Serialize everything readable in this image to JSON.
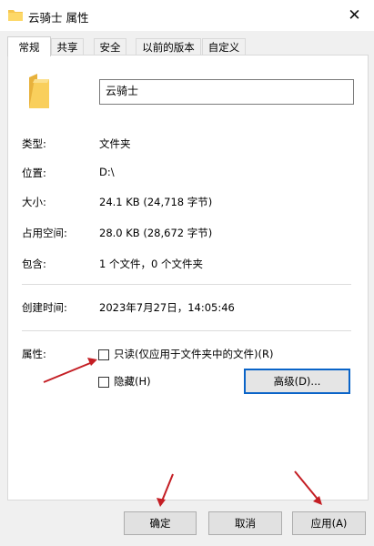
{
  "window": {
    "title": "云骑士 属性",
    "close_glyph": "✕"
  },
  "tabs": [
    {
      "label": "常规",
      "active": true
    },
    {
      "label": "共享",
      "active": false
    },
    {
      "label": "安全",
      "active": false
    },
    {
      "label": "以前的版本",
      "active": false
    },
    {
      "label": "自定义",
      "active": false
    }
  ],
  "general": {
    "folder_name": "云骑士",
    "rows": [
      {
        "label": "类型:",
        "value": "文件夹"
      },
      {
        "label": "位置:",
        "value": "D:\\"
      },
      {
        "label": "大小:",
        "value": "24.1 KB (24,718 字节)"
      },
      {
        "label": "占用空间:",
        "value": "28.0 KB (28,672 字节)"
      },
      {
        "label": "包含:",
        "value": "1 个文件，0 个文件夹"
      }
    ],
    "created_label": "创建时间:",
    "created_value": "2023年7月27日，14:05:46",
    "attributes_label": "属性:",
    "readonly_label": "只读(仅应用于文件夹中的文件)(R)",
    "readonly_checked": false,
    "hidden_label": "隐藏(H)",
    "hidden_checked": false,
    "advanced_button": "高级(D)..."
  },
  "footer": {
    "ok": "确定",
    "cancel": "取消",
    "apply": "应用(A)"
  },
  "colors": {
    "folder": "#f6c64e",
    "annotation_arrow": "#c41e24",
    "focus_border": "#0a64c8"
  },
  "icons": {
    "title": "folder-icon",
    "large": "folder-icon"
  }
}
